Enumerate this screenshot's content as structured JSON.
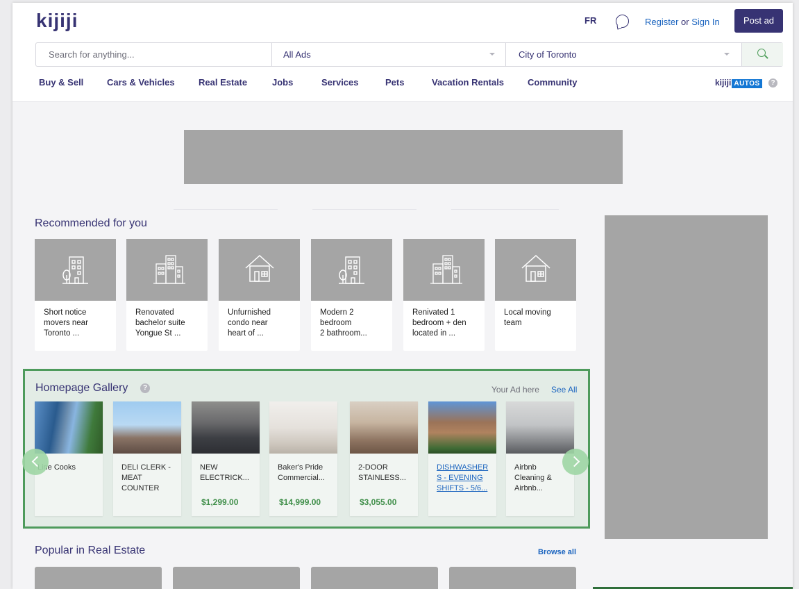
{
  "header": {
    "logo": "kijiji",
    "language_toggle": "FR",
    "register_label": "Register",
    "or_label": "or",
    "sign_in_label": "Sign In",
    "post_ad_label": "Post ad"
  },
  "search": {
    "placeholder": "Search for anything...",
    "category_value": "All Ads",
    "location_value": "City of Toronto"
  },
  "nav": {
    "items": [
      "Buy & Sell",
      "Cars & Vehicles",
      "Real Estate",
      "Jobs",
      "Services",
      "Pets",
      "Vacation Rentals",
      "Community"
    ],
    "autos_brand": "kijiji",
    "autos_badge": "AUTOS"
  },
  "recommended": {
    "title": "Recommended for you",
    "items": [
      {
        "line1": "Short notice",
        "line2": "movers near",
        "line3": "Toronto ...",
        "icon": "apartment-building-icon"
      },
      {
        "line1": "Renovated",
        "line2": "bachelor suite",
        "line3": "Yongue St ...",
        "icon": "office-buildings-icon"
      },
      {
        "line1": "Unfurnished",
        "line2": "condo near",
        "line3": "heart of  ...",
        "icon": "house-icon"
      },
      {
        "line1": "Modern 2",
        "line2": "bedroom",
        "line3": "2 bathroom...",
        "icon": "apartment-building-icon"
      },
      {
        "line1": "Renivated 1",
        "line2": "bedroom + den",
        "line3": "located in ...",
        "icon": "office-buildings-icon"
      },
      {
        "line1": "Local moving",
        "line2": "team",
        "line3": "",
        "icon": "house-icon"
      }
    ]
  },
  "gallery": {
    "title": "Homepage Gallery",
    "your_ad": "Your Ad here",
    "see_all": "See All",
    "items": [
      {
        "line1": "Line Cooks",
        "line2": "",
        "line3": "",
        "price": ""
      },
      {
        "line1": "DELI CLERK -",
        "line2": "MEAT",
        "line3": "COUNTER",
        "price": ""
      },
      {
        "line1": "NEW",
        "line2": "ELECTRICK...",
        "line3": "",
        "price": "$1,299.00"
      },
      {
        "line1": "Baker's Pride",
        "line2": "Commercial...",
        "line3": "",
        "price": "$14,999.00"
      },
      {
        "line1": "2-DOOR",
        "line2": "STAINLESS...",
        "line3": "",
        "price": "$3,055.00"
      },
      {
        "line1": "DISHWASHER",
        "line2": "S - EVENING",
        "line3": "SHIFTS - 5/6...",
        "price": ""
      },
      {
        "line1": "Airbnb",
        "line2": "Cleaning &",
        "line3": "Airbnb...",
        "price": ""
      }
    ]
  },
  "popular": {
    "title": "Popular in Real Estate",
    "browse_all": "Browse all"
  },
  "colors": {
    "brand": "#373373",
    "link": "#1b64bf",
    "gallery_border": "#4e9b5c",
    "price": "#3f8e49",
    "ad_placeholder": "#a5a5a5"
  }
}
